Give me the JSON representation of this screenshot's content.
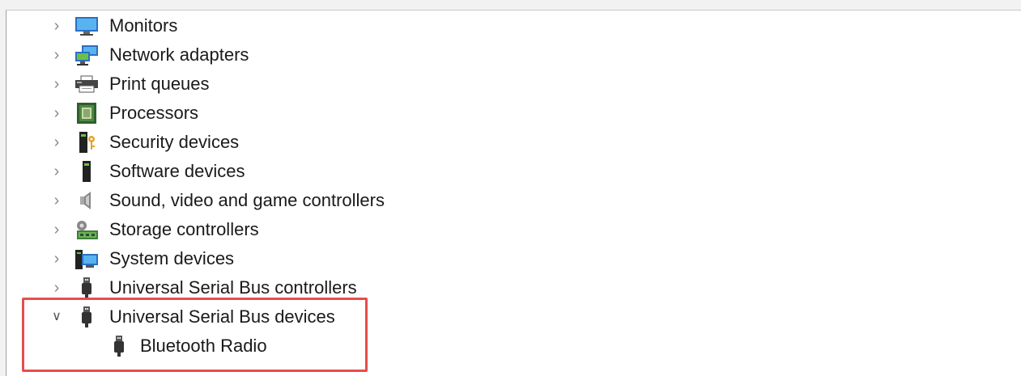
{
  "tree": {
    "items": [
      {
        "label": "Monitors",
        "icon": "monitor-icon",
        "expanded": false
      },
      {
        "label": "Network adapters",
        "icon": "network-adapter-icon",
        "expanded": false
      },
      {
        "label": "Print queues",
        "icon": "printer-icon",
        "expanded": false
      },
      {
        "label": "Processors",
        "icon": "processor-icon",
        "expanded": false
      },
      {
        "label": "Security devices",
        "icon": "security-device-icon",
        "expanded": false
      },
      {
        "label": "Software devices",
        "icon": "software-device-icon",
        "expanded": false
      },
      {
        "label": "Sound, video and game controllers",
        "icon": "speaker-icon",
        "expanded": false
      },
      {
        "label": "Storage controllers",
        "icon": "storage-controller-icon",
        "expanded": false
      },
      {
        "label": "System devices",
        "icon": "system-device-icon",
        "expanded": false
      },
      {
        "label": "Universal Serial Bus controllers",
        "icon": "usb-plug-icon",
        "expanded": false
      },
      {
        "label": "Universal Serial Bus devices",
        "icon": "usb-plug-icon",
        "expanded": true,
        "children": [
          {
            "label": "Bluetooth Radio",
            "icon": "usb-plug-icon"
          }
        ]
      }
    ]
  },
  "highlight_color": "#e84c4c"
}
